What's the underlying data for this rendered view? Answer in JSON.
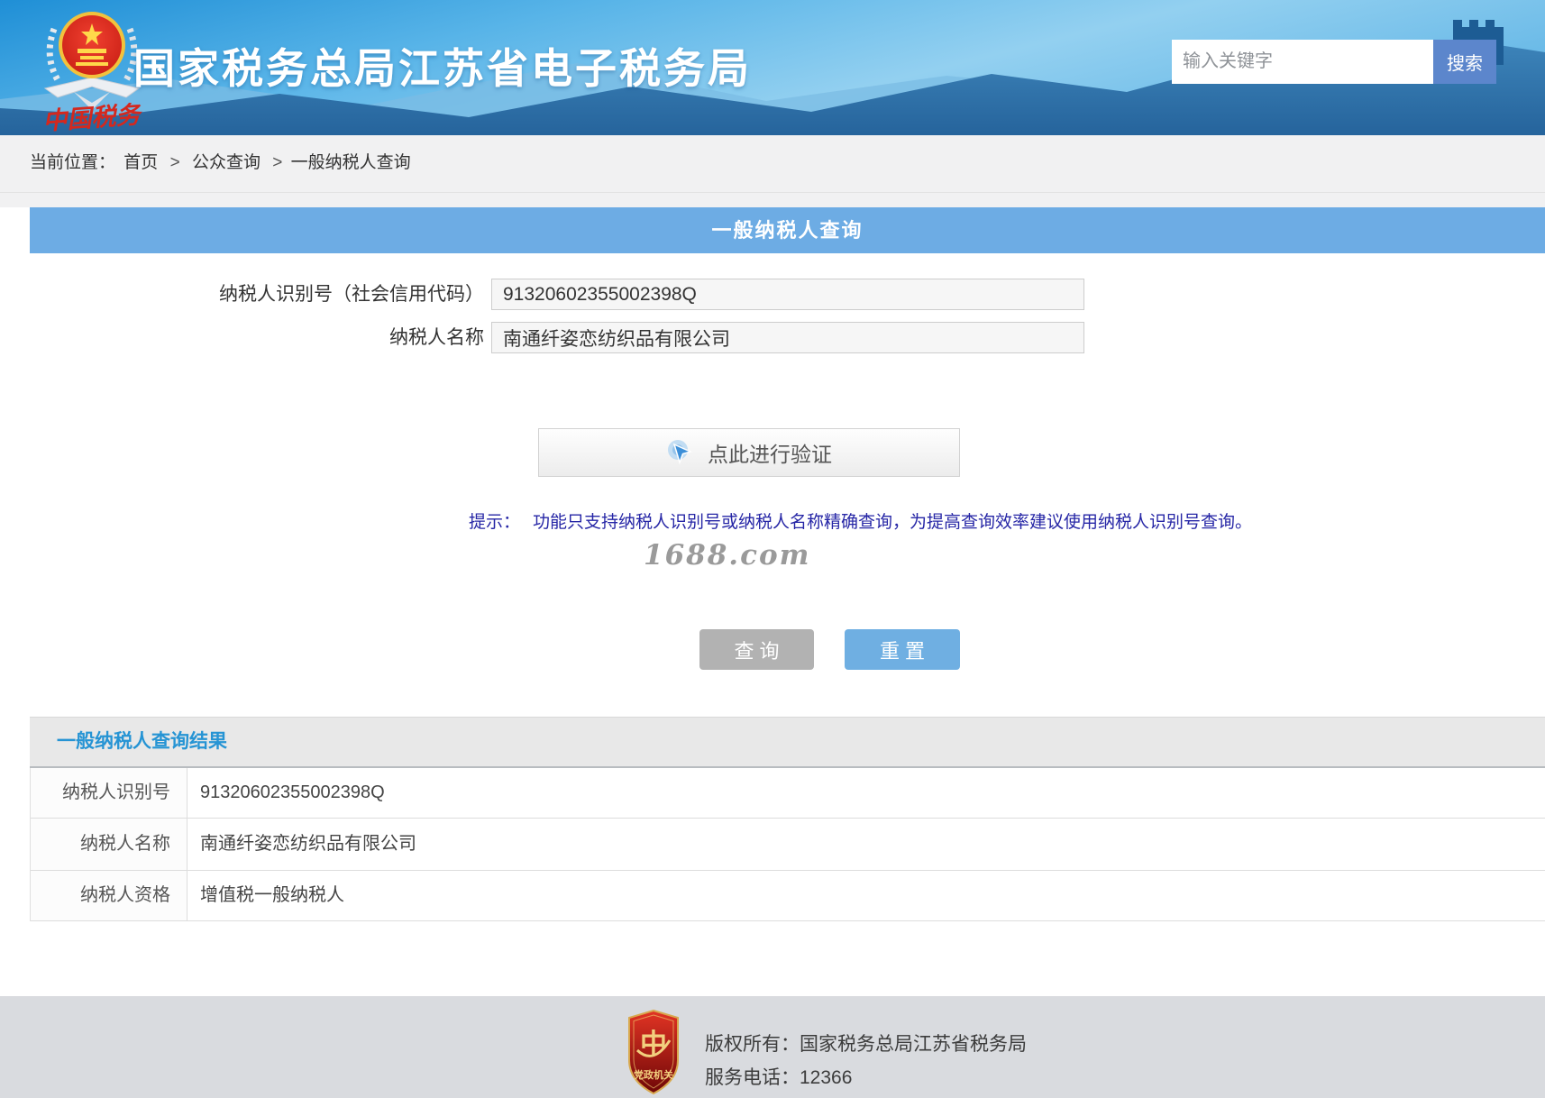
{
  "header": {
    "title": "国家税务总局江苏省电子税务局",
    "logo_caption": "中国税务",
    "search": {
      "placeholder": "输入关键字",
      "button_label": "搜索"
    }
  },
  "breadcrumb": {
    "prefix": "当前位置：",
    "items": [
      "首页",
      "公众查询",
      "一般纳税人查询"
    ],
    "separator": ">"
  },
  "banner": {
    "title": "一般纳税人查询"
  },
  "form": {
    "fields": [
      {
        "label": "纳税人识别号（社会信用代码）",
        "value": "91320602355002398Q"
      },
      {
        "label": "纳税人名称",
        "value": "南通纤姿恋纺织品有限公司"
      }
    ],
    "verify_button": "点此进行验证",
    "hint_label": "提示：",
    "hint_text": "功能只支持纳税人识别号或纳税人名称精确查询，为提高查询效率建议使用纳税人识别号查询。",
    "watermark": "1688.com",
    "query_button": "查 询",
    "reset_button": "重 置"
  },
  "results": {
    "title": "一般纳税人查询结果",
    "rows": [
      {
        "label": "纳税人识别号",
        "value": "91320602355002398Q"
      },
      {
        "label": "纳税人名称",
        "value": "南通纤姿恋纺织品有限公司"
      },
      {
        "label": "纳税人资格",
        "value": "增值税一般纳税人"
      }
    ]
  },
  "footer": {
    "badge_label": "党政机关",
    "copyright": "版权所有：国家税务总局江苏省税务局",
    "phone": "服务电话：12366"
  },
  "colors": {
    "banner_blue": "#6dace4",
    "search_button_blue": "#5c86cc",
    "reset_button_blue": "#6fafe2",
    "query_button_gray": "#b2b2b2",
    "results_title_blue": "#2694d4",
    "hint_navy": "#2626a6",
    "footer_gray": "#d9dbdf",
    "badge_red": "#a51212"
  }
}
